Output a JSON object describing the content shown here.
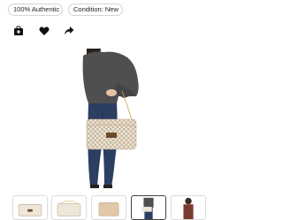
{
  "badges": {
    "authentic": "100% Authentic",
    "condition": "Condition: New"
  },
  "actions": [
    {
      "icon": "shopping-bag-plus-icon"
    },
    {
      "icon": "heart-icon"
    },
    {
      "icon": "share-arrow-icon"
    }
  ],
  "gallery": {
    "selected_index": 3,
    "thumbnails": [
      {
        "icon": "bag-thumbnail"
      },
      {
        "icon": "bag-thumbnail"
      },
      {
        "icon": "bag-thumbnail"
      },
      {
        "icon": "model-thumbnail"
      },
      {
        "icon": "model-thumbnail"
      }
    ]
  },
  "colors": {
    "badge_border": "#cfd5dc",
    "sweater": "#4f4f4f",
    "jeans": "#2c3e62",
    "checker_light": "#eee6d8",
    "checker_dark": "#b9a990",
    "active_thumb_border": "#444444"
  }
}
